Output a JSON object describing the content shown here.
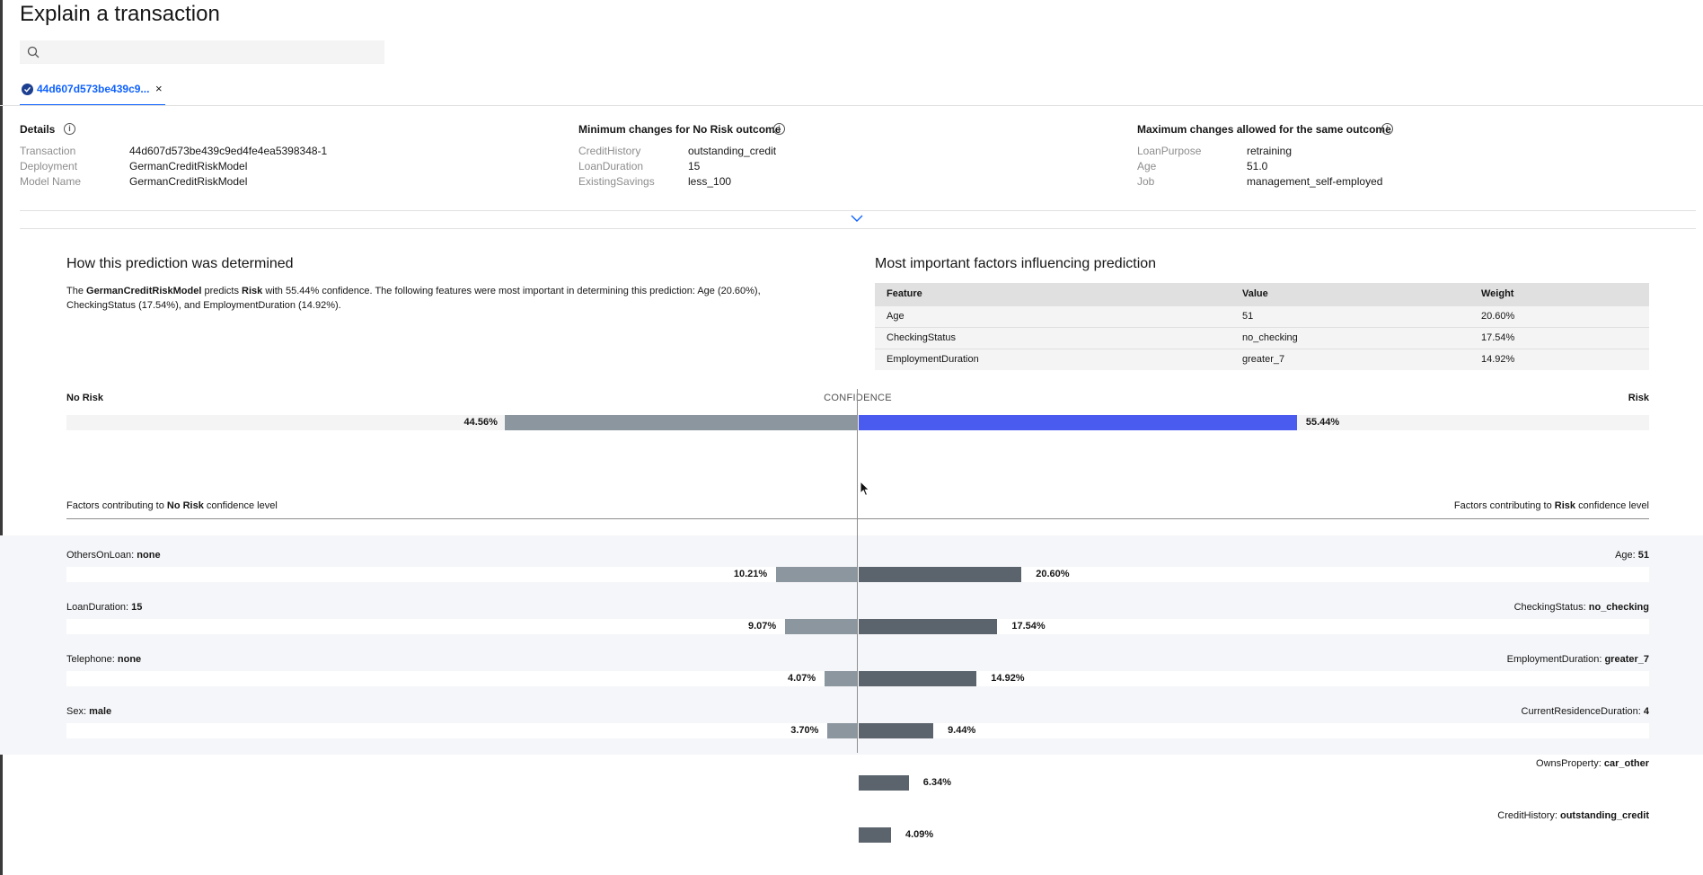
{
  "page": {
    "title": "Explain a transaction"
  },
  "search": {
    "placeholder": ""
  },
  "tab": {
    "label": "44d607d573be439c9...",
    "close": "×"
  },
  "details": {
    "heading": "Details",
    "rows": [
      {
        "key": "Transaction",
        "value": "44d607d573be439c9ed4fe4ea5398348-1"
      },
      {
        "key": "Deployment",
        "value": "GermanCreditRiskModel"
      },
      {
        "key": "Model Name",
        "value": "GermanCreditRiskModel"
      }
    ]
  },
  "min_changes": {
    "heading": "Minimum changes for No Risk outcome",
    "rows": [
      {
        "key": "CreditHistory",
        "value": "outstanding_credit"
      },
      {
        "key": "LoanDuration",
        "value": "15"
      },
      {
        "key": "ExistingSavings",
        "value": "less_100"
      }
    ]
  },
  "max_changes": {
    "heading": "Maximum changes allowed for the same outcome",
    "rows": [
      {
        "key": "LoanPurpose",
        "value": "retraining"
      },
      {
        "key": "Age",
        "value": "51.0"
      },
      {
        "key": "Job",
        "value": "management_self-employed"
      }
    ]
  },
  "prediction": {
    "heading": "How this prediction was determined",
    "text_1": "The ",
    "model": "GermanCreditRiskModel",
    "text_2": " predicts ",
    "outcome": "Risk",
    "text_3": " with 55.44% confidence. The following features were most important in determining this prediction: Age (20.60%), CheckingStatus (17.54%), and EmploymentDuration (14.92%)."
  },
  "factors": {
    "heading": "Most important factors influencing prediction",
    "columns": [
      "Feature",
      "Value",
      "Weight"
    ],
    "rows": [
      [
        "Age",
        "51",
        "20.60%"
      ],
      [
        "CheckingStatus",
        "no_checking",
        "17.54%"
      ],
      [
        "EmploymentDuration",
        "greater_7",
        "14.92%"
      ]
    ]
  },
  "confidence": {
    "left_label": "No Risk",
    "center_label": "CONFIDENCE",
    "right_label": "Risk",
    "no_risk_value": 44.56,
    "no_risk_text": "44.56%",
    "risk_value": 55.44,
    "risk_text": "55.44%",
    "colors": {
      "no_risk": "#8c969f",
      "risk": "#4a5cf0"
    }
  },
  "contrib": {
    "left_prefix": "Factors contributing to ",
    "left_bold": "No Risk",
    "left_suffix": " confidence level",
    "right_prefix": "Factors contributing to ",
    "right_bold": "Risk",
    "right_suffix": " confidence level",
    "colors": {
      "left": "#8c969f",
      "right": "#5b646d"
    },
    "rows": [
      {
        "left_name": "OthersOnLoan: ",
        "left_val": "none",
        "left_pct": 10.21,
        "left_text": "10.21%",
        "right_name": "Age: ",
        "right_val": "51",
        "right_pct": 20.6,
        "right_text": "20.60%"
      },
      {
        "left_name": "LoanDuration: ",
        "left_val": "15",
        "left_pct": 9.07,
        "left_text": "9.07%",
        "right_name": "CheckingStatus: ",
        "right_val": "no_checking",
        "right_pct": 17.54,
        "right_text": "17.54%"
      },
      {
        "left_name": "Telephone: ",
        "left_val": "none",
        "left_pct": 4.07,
        "left_text": "4.07%",
        "right_name": "EmploymentDuration: ",
        "right_val": "greater_7",
        "right_pct": 14.92,
        "right_text": "14.92%"
      },
      {
        "left_name": "Sex: ",
        "left_val": "male",
        "left_pct": 3.7,
        "left_text": "3.70%",
        "right_name": "CurrentResidenceDuration: ",
        "right_val": "4",
        "right_pct": 9.44,
        "right_text": "9.44%"
      },
      {
        "right_name": "OwnsProperty: ",
        "right_val": "car_other",
        "right_pct": 6.34,
        "right_text": "6.34%"
      },
      {
        "right_name": "CreditHistory: ",
        "right_val": "outstanding_credit",
        "right_pct": 4.09,
        "right_text": "4.09%"
      }
    ]
  }
}
